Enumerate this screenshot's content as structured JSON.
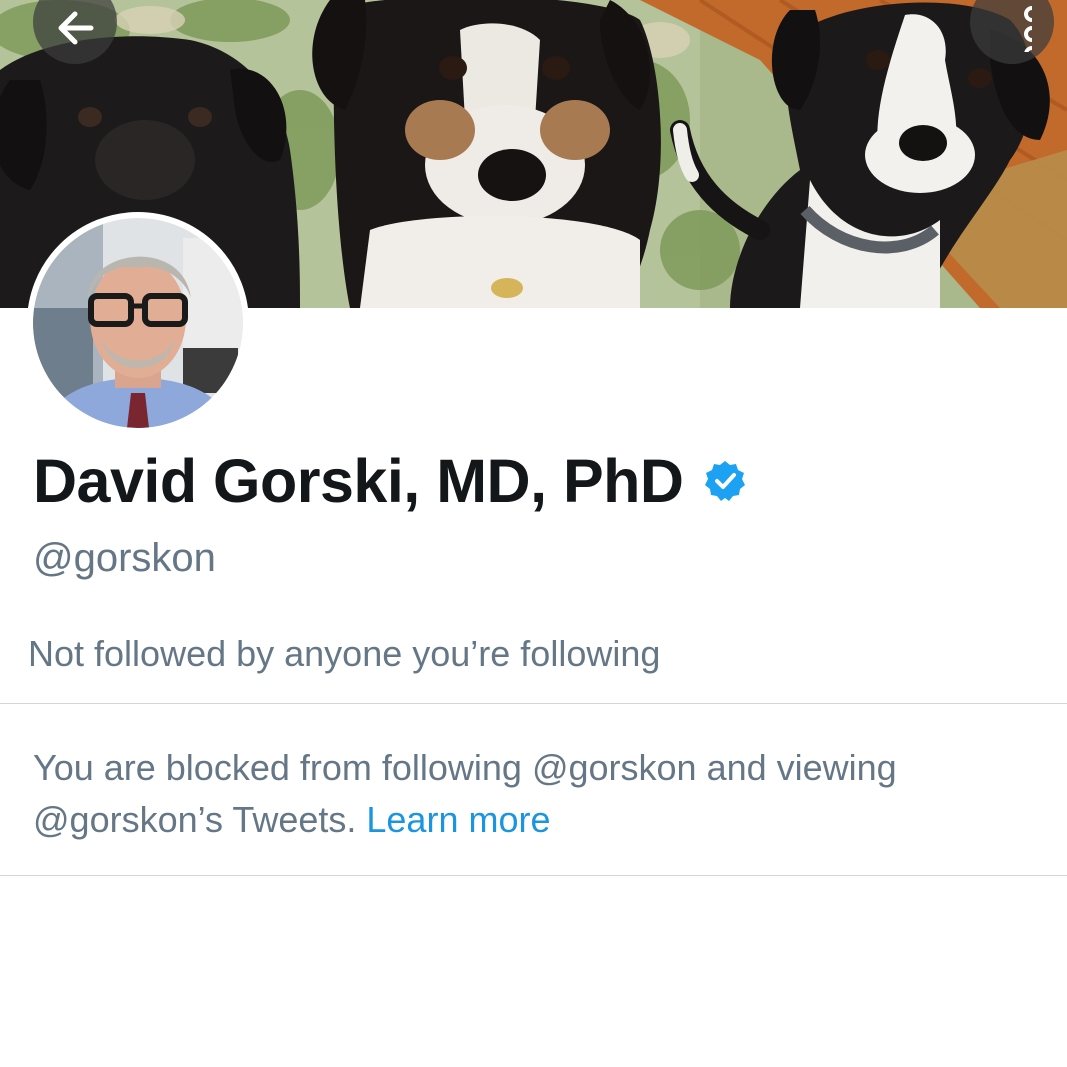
{
  "header": {
    "back_icon": "arrow-left-icon",
    "more_icon": "more-vertical-icon"
  },
  "profile": {
    "display_name": "David Gorski, MD, PhD",
    "verified": true,
    "verified_icon": "verified-badge-icon",
    "handle": "@gorskon",
    "followed_by_text": "Not followed by anyone you’re following"
  },
  "blocked_notice": {
    "message": "You are blocked from following @gorskon and viewing @gorskon’s Tweets.",
    "link_label": "Learn more"
  },
  "colors": {
    "accent": "#1da1f2",
    "link": "#1b95e0",
    "secondary_text": "#657786",
    "primary_text": "#14171a"
  }
}
